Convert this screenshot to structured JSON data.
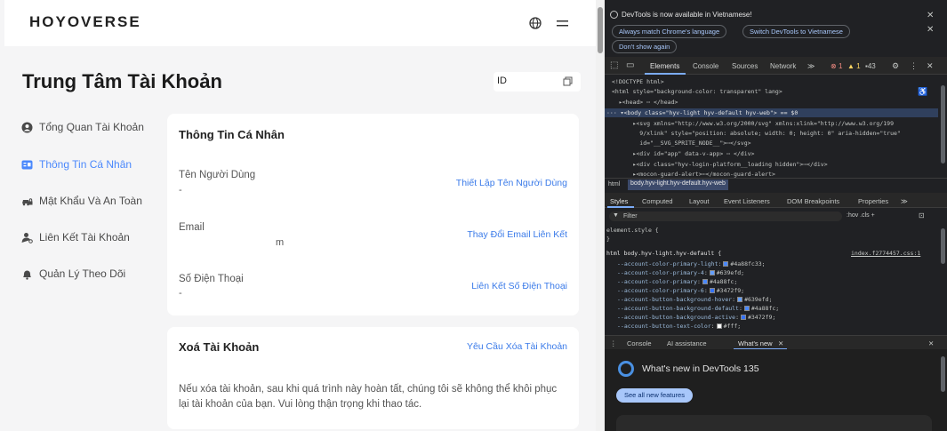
{
  "page": {
    "logo": "HOYOVERSE",
    "title": "Trung Tâm Tài Khoản",
    "id_label": "ID",
    "nav": [
      {
        "label": "Tổng Quan Tài Khoản",
        "icon": "user-circle-icon"
      },
      {
        "label": "Thông Tin Cá Nhân",
        "icon": "id-card-icon"
      },
      {
        "label": "Mật Khẩu Và An Toàn",
        "icon": "lock-car-icon"
      },
      {
        "label": "Liên Kết Tài Khoản",
        "icon": "person-link-icon"
      },
      {
        "label": "Quản Lý Theo Dõi",
        "icon": "bell-icon"
      }
    ],
    "personal": {
      "heading": "Thông Tin Cá Nhân",
      "username_label": "Tên Người Dùng",
      "username_value": "-",
      "username_link": "Thiết Lập Tên Người Dùng",
      "email_label": "Email",
      "email_value": "m",
      "email_link": "Thay Đổi Email Liên Kết",
      "phone_label": "Số Điện Thoại",
      "phone_value": "-",
      "phone_link": "Liên Kết Số Điện Thoại"
    },
    "delete": {
      "heading": "Xoá Tài Khoản",
      "link": "Yêu Cầu Xóa Tài Khoản",
      "para1": "Nếu xóa tài khoản, sau khi quá trình này hoàn tất, chúng tôi sẽ không thể khôi phục",
      "para2": "lại tài khoản của bạn. Vui lòng thận trọng khi thao tác."
    },
    "accent_color": "#4a88fc"
  },
  "devtools": {
    "banner": "DevTools is now available in Vietnamese!",
    "btn_match": "Always match Chrome's language",
    "btn_switch": "Switch DevTools to Vietnamese",
    "btn_dont": "Don't show again",
    "tabs": [
      "Elements",
      "Console",
      "Sources",
      "Network"
    ],
    "more": "≫",
    "errors": "1",
    "warnings": "1",
    "issues": "43",
    "dom": [
      "<!DOCTYPE html>",
      "<html style=\"background-color: transparent\" lang>",
      "  ▸<head> ⋯ </head>",
      "··· ▾<body class=\"hyv-light hyv-default hyv-web\"> == $0",
      "      ▸<svg xmlns=\"http://www.w3.org/2000/svg\" xmlns:xlink=\"http://www.w3.org/199",
      "        9/xlink\" style=\"position: absolute; width: 0; height: 0\" aria-hidden=\"true\"",
      "        id=\"__SVG_SPRITE_NODE__\">⋯</svg>",
      "      ▸<div id=\"app\" data-v-app> ⋯ </div>",
      "      ▸<div class=\"hyv-login-platform__loading hidden\">⋯</div>",
      "      ▸<mocon-guard-alert>⋯</mocon-guard-alert>"
    ],
    "crumb_html": "html",
    "crumb_body": "body.hyv-light.hyv-default.hyv-web",
    "subtabs": [
      "Styles",
      "Computed",
      "Layout",
      "Event Listeners",
      "DOM Breakpoints",
      "Properties"
    ],
    "filter_placeholder": "Filter",
    "filter_opts": ":hov  .cls  +",
    "element_style": "element.style {",
    "close_brace": "}",
    "rule_selector": "html body.hyv-light.hyv-default {",
    "rule_source": "index.f2774457.css:1",
    "vars": [
      {
        "name": "--account-color-primary-light",
        "value": "#4a88fc33",
        "color": "#4a88fc"
      },
      {
        "name": "--account-color-primary-4",
        "value": "#639efd",
        "color": "#639efd"
      },
      {
        "name": "--account-color-primary",
        "value": "#4a88fc",
        "color": "#4a88fc"
      },
      {
        "name": "--account-color-primary-6",
        "value": "#3472f9",
        "color": "#3472f9"
      },
      {
        "name": "--account-button-background-hover",
        "value": "#639efd",
        "color": "#639efd"
      },
      {
        "name": "--account-button-background-default",
        "value": "#4a88fc",
        "color": "#4a88fc"
      },
      {
        "name": "--account-button-background-active",
        "value": "#3472f9",
        "color": "#3472f9"
      },
      {
        "name": "--account-button-text-color",
        "value": "#fff",
        "color": "#ffffff"
      }
    ],
    "drawer_tabs": [
      "Console",
      "AI assistance",
      "What's new"
    ],
    "whatsnew_title": "What's new in DevTools 135",
    "whatsnew_btn": "See all new features"
  }
}
